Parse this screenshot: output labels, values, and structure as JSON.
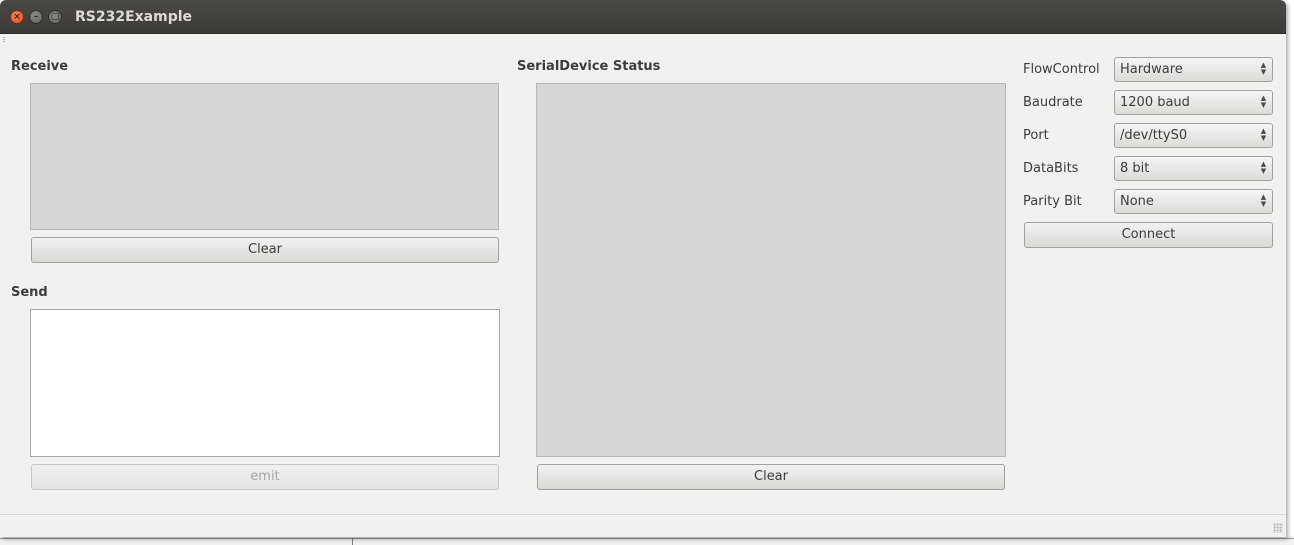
{
  "window": {
    "title": "RS232Example"
  },
  "receive": {
    "label": "Receive",
    "clear_label": "Clear"
  },
  "send": {
    "label": "Send",
    "emit_label": "emit"
  },
  "status": {
    "label": "SerialDevice Status",
    "clear_label": "Clear"
  },
  "settings": {
    "flow_control": {
      "label": "FlowControl",
      "value": "Hardware"
    },
    "baudrate": {
      "label": "Baudrate",
      "value": "1200 baud"
    },
    "port": {
      "label": "Port",
      "value": "/dev/ttyS0"
    },
    "databits": {
      "label": "DataBits",
      "value": "8 bit"
    },
    "parity": {
      "label": "Parity Bit",
      "value": "None"
    },
    "connect_label": "Connect"
  },
  "colors": {
    "titlebar": "#3c3b37",
    "window_bg": "#f2f1f0",
    "panel_gray": "#d6d6d6",
    "close_button": "#e0451c"
  }
}
